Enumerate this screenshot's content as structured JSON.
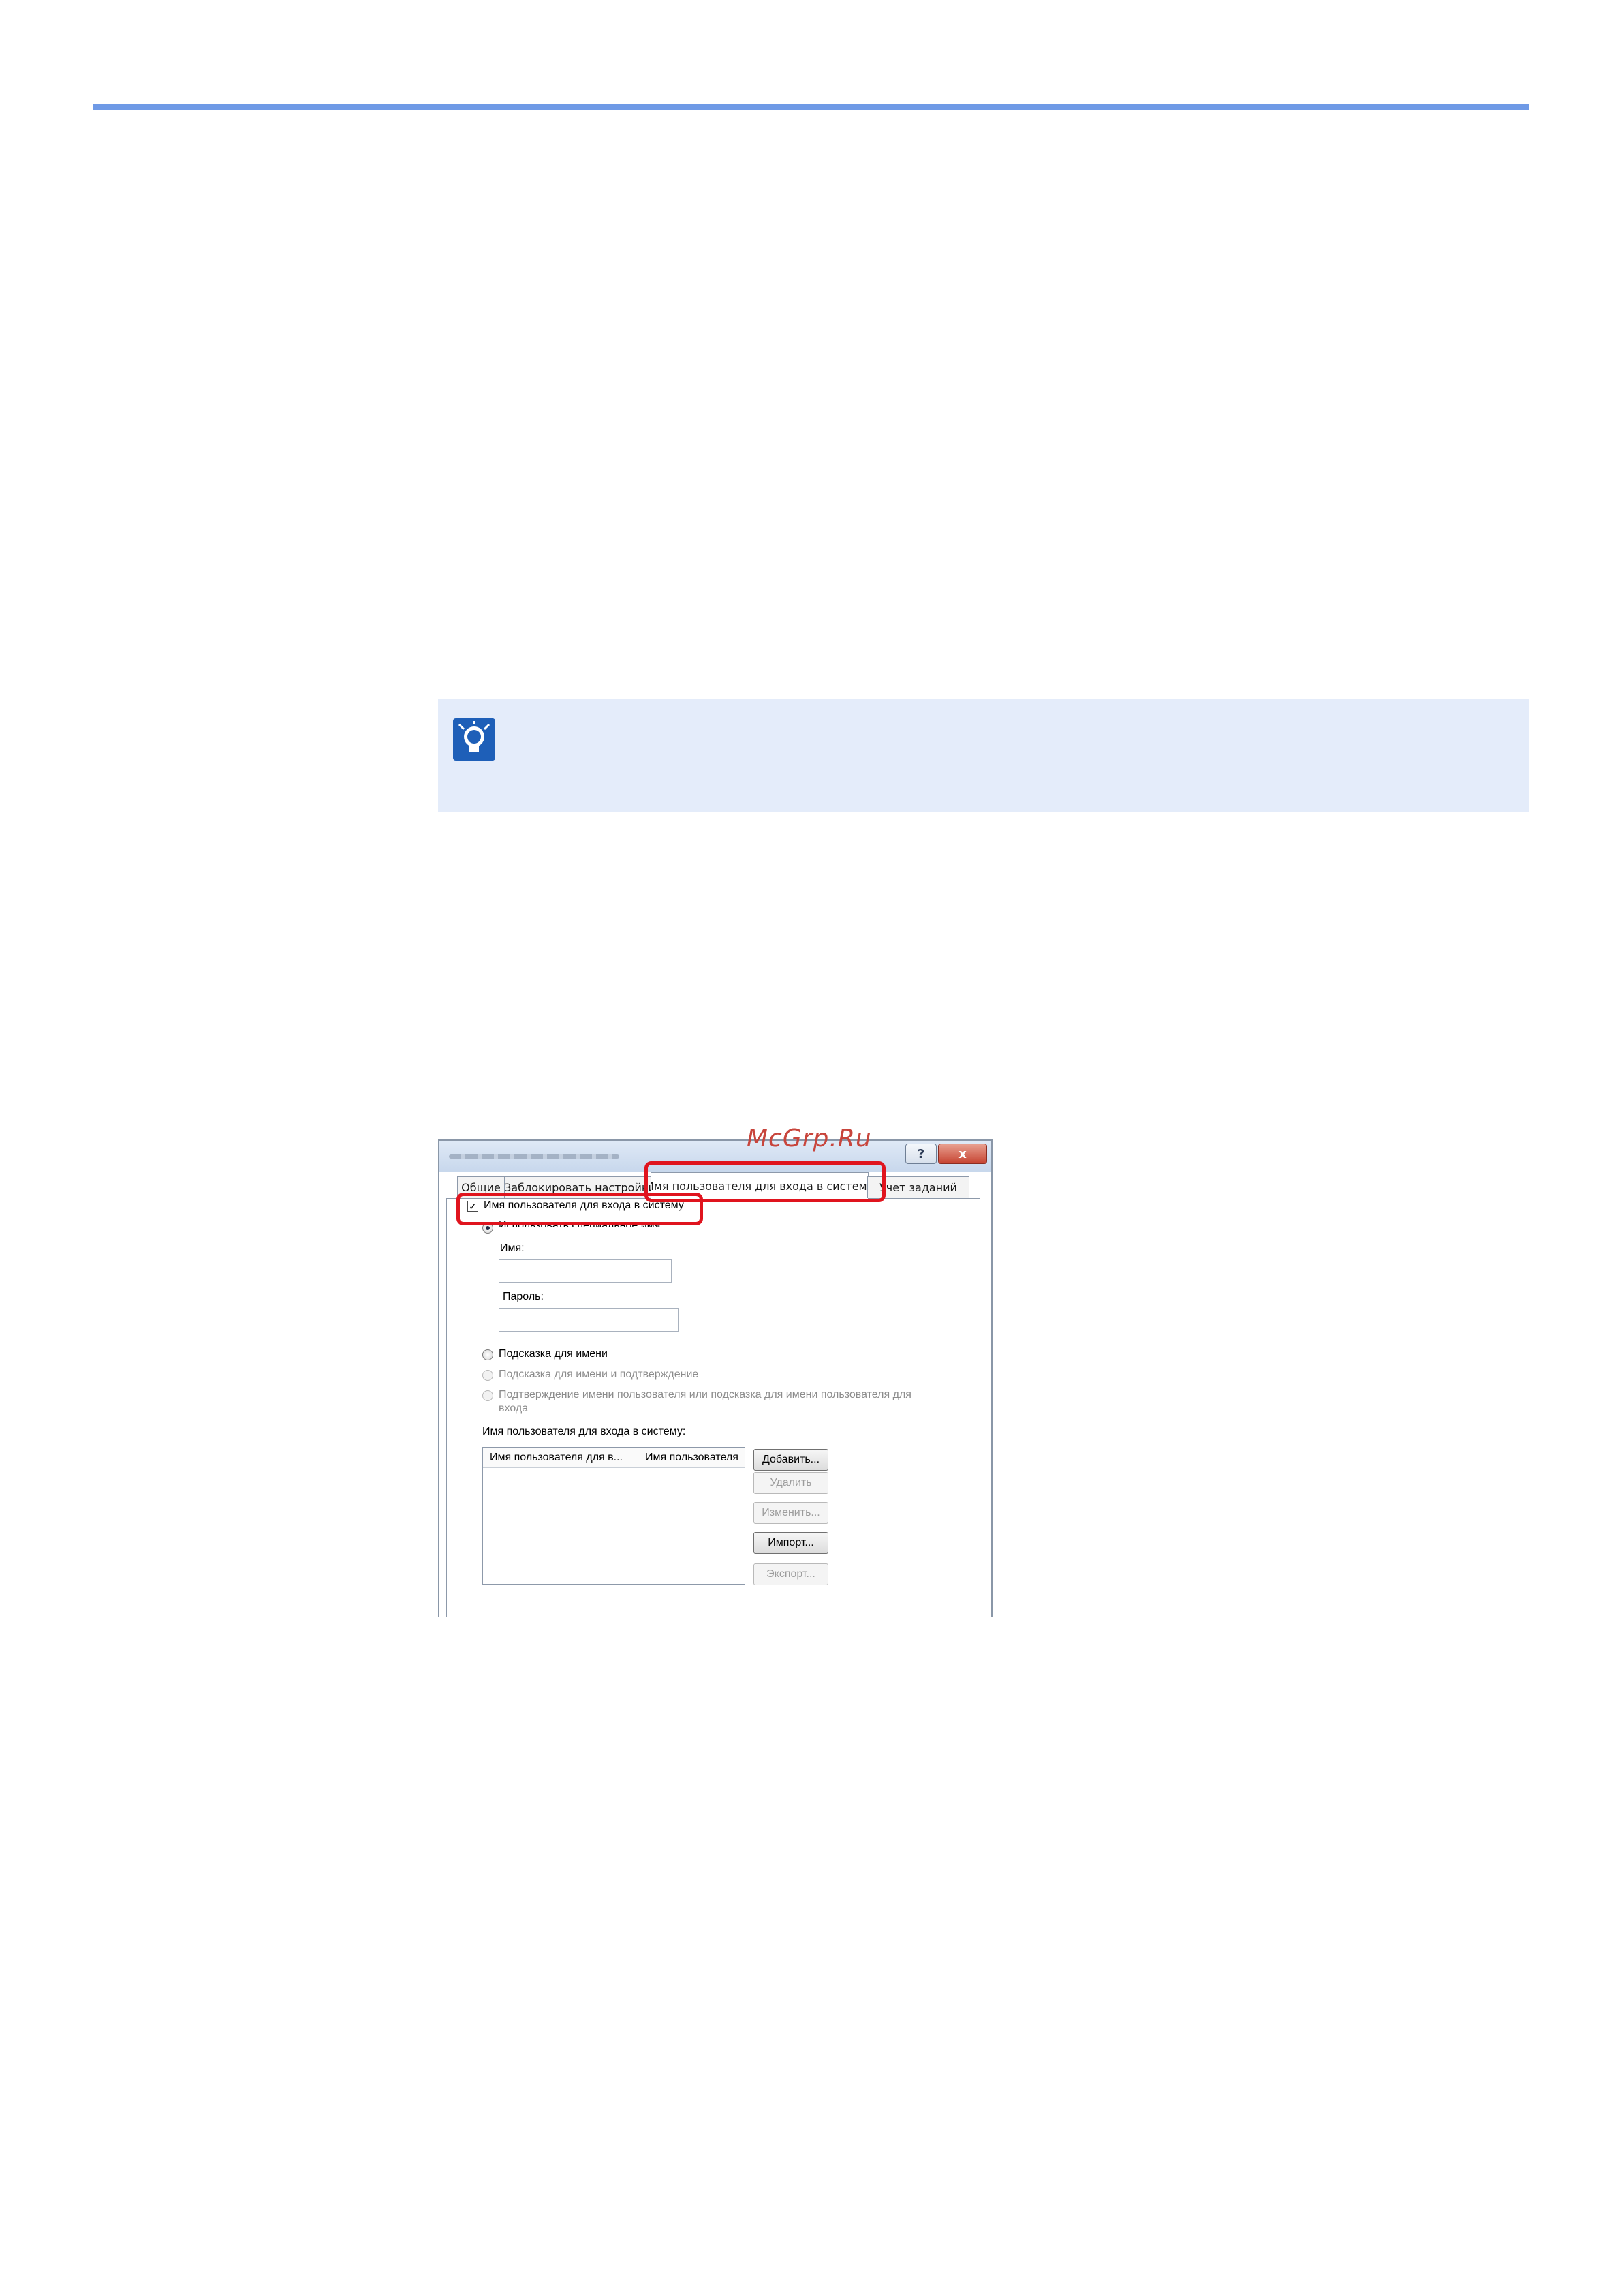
{
  "watermark": "McGrp.Ru",
  "note": {
    "icon": "lightbulb-hint-icon",
    "accent": "#1e5fb8"
  },
  "colors": {
    "rule": "#6f9ae6",
    "note_bg": "#e4ecfa",
    "highlight": "#e0141e"
  },
  "dialog": {
    "help_label": "?",
    "close_label": "x",
    "tabs": [
      {
        "label": "Общие"
      },
      {
        "label": "Заблокировать настройки"
      },
      {
        "label": "Имя пользователя для входа в систему",
        "active": true
      },
      {
        "label": "Учет заданий"
      }
    ],
    "login_checkbox": {
      "label": "Имя пользователя для входа в систему",
      "checked": true
    },
    "use_specific": {
      "label": "Использовать специальное имя",
      "selected": true
    },
    "name_label": "Имя:",
    "name_value": "",
    "password_label": "Пароль:",
    "password_value": "",
    "radio_prompt_name": "Подсказка для имени",
    "radio_prompt_confirm": "Подсказка для имени и подтверждение",
    "radio_confirm_line1": "Подтверждение имени пользователя или подсказка для имени пользователя для",
    "radio_confirm_line2": "входа",
    "list_title": "Имя пользователя для входа в систему:",
    "list_columns": [
      "Имя пользователя для в...",
      "Имя пользователя"
    ],
    "buttons": {
      "add": "Добавить...",
      "delete": "Удалить",
      "edit": "Изменить...",
      "import": "Импорт...",
      "export": "Экспорт..."
    }
  }
}
